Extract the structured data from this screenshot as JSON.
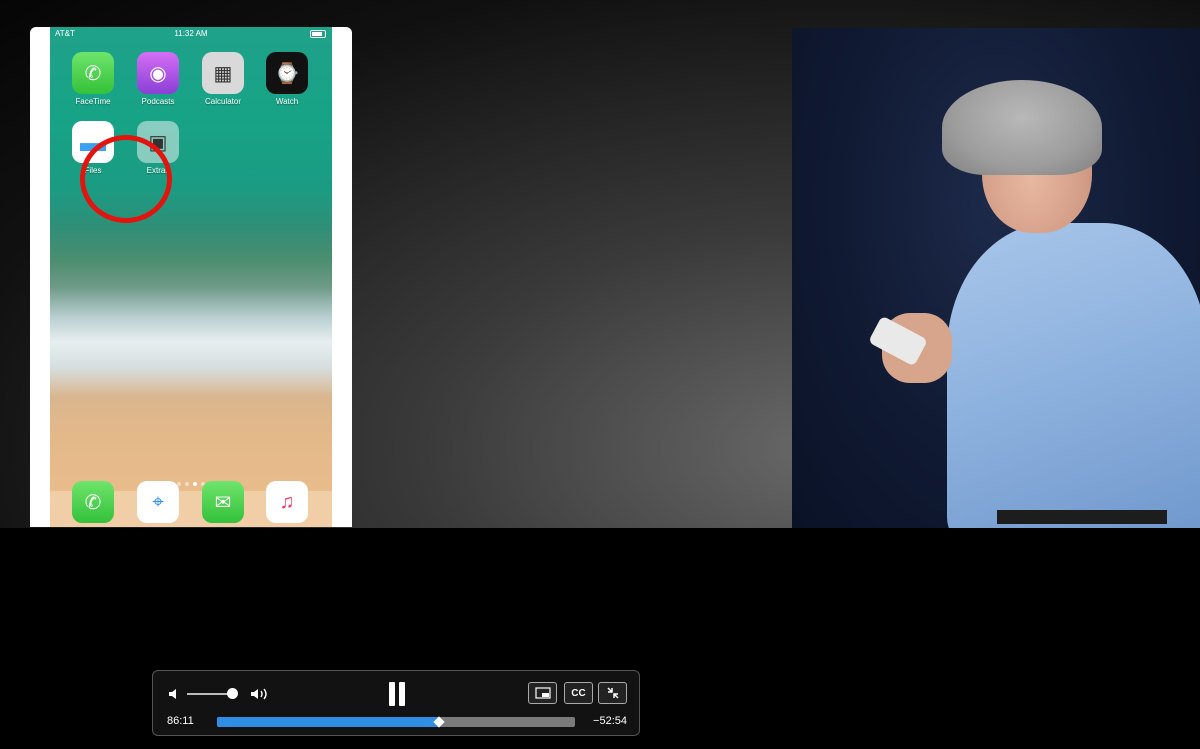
{
  "phone": {
    "status": {
      "carrier": "AT&T",
      "time": "11:32 AM"
    },
    "apps": [
      {
        "label": "FaceTime",
        "glyph": "✆",
        "icon": "facetime-icon"
      },
      {
        "label": "Podcasts",
        "glyph": "◉",
        "icon": "podcasts-icon"
      },
      {
        "label": "Calculator",
        "glyph": "▦",
        "icon": "calculator-icon"
      },
      {
        "label": "Watch",
        "glyph": "⌚",
        "icon": "watch-icon"
      },
      {
        "label": "Files",
        "glyph": "▬",
        "icon": "files-icon"
      },
      {
        "label": "Extras",
        "glyph": "▣",
        "icon": "extras-folder-icon"
      }
    ],
    "dock": [
      {
        "glyph": "✆",
        "icon": "phone-icon"
      },
      {
        "glyph": "⌖",
        "icon": "safari-icon"
      },
      {
        "glyph": "✉",
        "icon": "messages-icon"
      },
      {
        "glyph": "♫",
        "icon": "music-icon"
      }
    ],
    "highlight_color": "#e3130e"
  },
  "player": {
    "elapsed": "86:11",
    "remaining": "−52:54",
    "progress": 0.62,
    "volume": 0.9,
    "cc_label": "CC",
    "accent": "#2f8de4"
  }
}
